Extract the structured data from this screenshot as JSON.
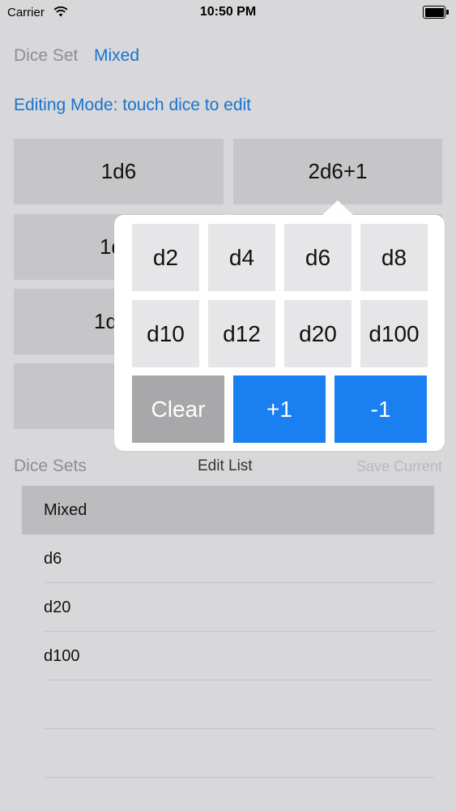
{
  "status_bar": {
    "carrier": "Carrier",
    "time": "10:50 PM",
    "wifi_icon": "wifi-icon",
    "battery_icon": "battery-icon"
  },
  "header": {
    "dice_set_label": "Dice Set",
    "dice_set_value": "Mixed",
    "editing_mode": "Editing Mode: touch dice to edit"
  },
  "dice_buttons": [
    "1d6",
    "2d6+1",
    "1d",
    "1d"
  ],
  "popover": {
    "dice": [
      "d2",
      "d4",
      "d6",
      "d8",
      "d10",
      "d12",
      "d20",
      "d100"
    ],
    "clear_label": "Clear",
    "plus_label": "+1",
    "minus_label": "-1"
  },
  "dice_sets": {
    "label": "Dice Sets",
    "edit_list": "Edit List",
    "save_current": "Save Current",
    "items": [
      "Mixed",
      "d6",
      "d20",
      "d100"
    ],
    "selected": "Mixed"
  },
  "colors": {
    "accent": "#1a73cf",
    "action_blue": "#1a7ff0",
    "clear_gray": "#a8a8aa",
    "background": "#d8d8da"
  }
}
